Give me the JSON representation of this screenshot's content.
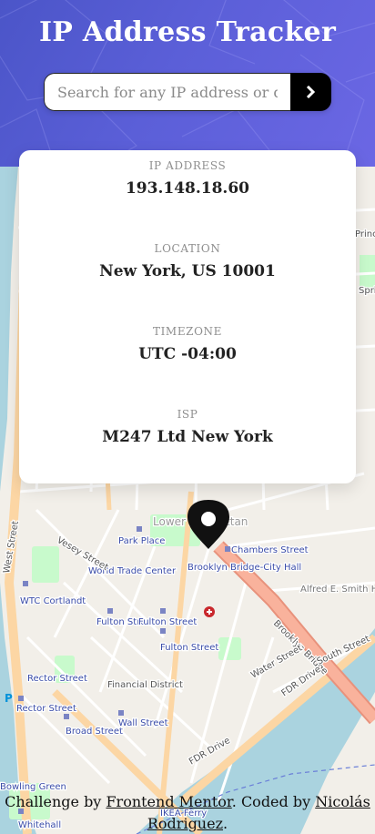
{
  "header": {
    "title": "IP Address Tracker",
    "search_placeholder": "Search for any IP address or domain",
    "search_value": "",
    "submit_icon": "chevron-right-icon"
  },
  "info": {
    "ip_label": "IP ADDRESS",
    "ip_value": "193.148.18.60",
    "location_label": "LOCATION",
    "location_value": "New York, US 10001",
    "timezone_label": "TIMEZONE",
    "timezone_value": "UTC -04:00",
    "isp_label": "ISP",
    "isp_value": "M247 Ltd New York"
  },
  "map": {
    "marker_icon": "location-pin-icon",
    "labels": {
      "lower_manhattan": "Lower Manhattan",
      "park_place": "Park Place",
      "chambers_street": "Chambers Street",
      "brooklyn_bridge_city_hall": "Brooklyn Bridge-City Hall",
      "world_trade_center": "World Trade Center",
      "wtc_cortlandt": "WTC Cortlandt",
      "fulton_street_1": "Fulton Street",
      "fulton_street_2": "Fulton Street",
      "fulton_street_3": "Fulton Street",
      "financial_district": "Financial District",
      "rector_street_1": "Rector Street",
      "rector_street_2": "Rector Street",
      "broad_street": "Broad Street",
      "wall_street": "Wall Street",
      "bowling_green": "Bowling Green",
      "whitehall": "Whitehall",
      "brooklyn_bridge": "Brooklyn Bridge",
      "fdr_drive_1": "FDR Drive",
      "fdr_drive_2": "FDR Drive",
      "south_street": "South Street",
      "water_street": "Water Street",
      "alfred_e_smith_houses": "Alfred E. Smith Houses",
      "west_street": "West Street",
      "vesey_street": "Vesey Street",
      "spring": "Spring",
      "prince": "Prince",
      "ikea_ferry": "IKEA Ferry"
    },
    "colors": {
      "water": "#aad3df",
      "land": "#f2efe9",
      "major_road": "#fcd6a4",
      "primary_road": "#f9b29c",
      "park": "#c8facc",
      "rail": "#8a8a8a"
    }
  },
  "footer": {
    "text_before": "Challenge by",
    "link1": "Frontend Mentor",
    "text_middle": ". Coded by",
    "link2": "Nicolás Rodriguez",
    "text_after": "."
  }
}
